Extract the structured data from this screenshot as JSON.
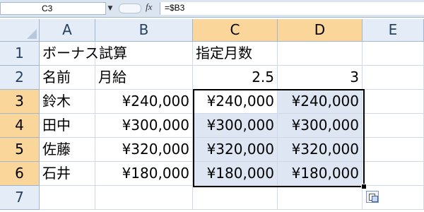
{
  "formula_bar": {
    "name_box": "C3",
    "fx_label": "fx",
    "formula": "=$B3"
  },
  "columns": [
    "A",
    "B",
    "C",
    "D",
    "E"
  ],
  "rows": [
    {
      "num": "1",
      "a": "ボーナス試算",
      "b": "",
      "c": "指定月数",
      "d": ""
    },
    {
      "num": "2",
      "a": "名前",
      "b": "月給",
      "c": "2.5",
      "d": "3"
    },
    {
      "num": "3",
      "a": "鈴木",
      "b": "¥240,000",
      "c": "¥240,000",
      "d": "¥240,000"
    },
    {
      "num": "4",
      "a": "田中",
      "b": "¥300,000",
      "c": "¥300,000",
      "d": "¥300,000"
    },
    {
      "num": "5",
      "a": "佐藤",
      "b": "¥320,000",
      "c": "¥320,000",
      "d": "¥320,000"
    },
    {
      "num": "6",
      "a": "石井",
      "b": "¥180,000",
      "c": "¥180,000",
      "d": "¥180,000"
    },
    {
      "num": "7",
      "a": "",
      "b": "",
      "c": "",
      "d": ""
    }
  ],
  "selection": {
    "range": "C3:D6",
    "active_cell": "C3"
  },
  "colors": {
    "selected_header": "#fbd69a",
    "selection_fill": "#dde6f2"
  }
}
